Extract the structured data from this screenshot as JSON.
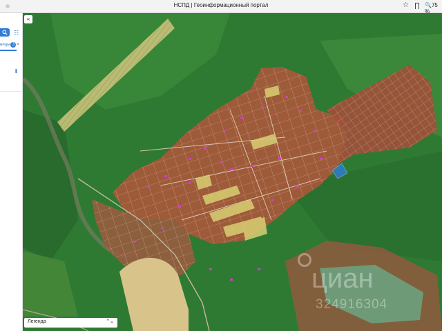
{
  "window": {
    "title": "НСПД | Геоинформационный портал",
    "zoom": "75 %"
  },
  "sidebar": {
    "search_icon": "search-icon",
    "list_icon": "list-icon",
    "chip_label": "ницы",
    "chip_count": "3",
    "chip_close": "×",
    "download_icon": "download-icon"
  },
  "map": {
    "collapse_icon": "«",
    "legend_label": "Легенда",
    "legend_chevron": "⌃⌄",
    "watermark_brand": "циан",
    "watermark_number": "324916304",
    "colors": {
      "forest": "#2f7a34",
      "field": "#5a9b3e",
      "settlement_overlay": "#b0603e",
      "parcel_outline": "#e0a0a0",
      "highlight_parcel": "#c8c36a",
      "building": "#d040c8",
      "selected_parcel": "#2f7dd6",
      "pond": "#6f9a78"
    }
  }
}
